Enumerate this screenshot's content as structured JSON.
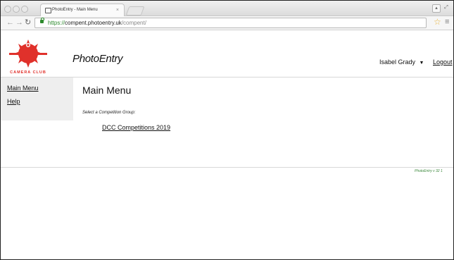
{
  "browser": {
    "tab_title": "PhotoEntry - Main Menu",
    "tab_close": "×",
    "url_scheme": "https://",
    "url_host": "compent.photoentry.uk",
    "url_path": "/compent/",
    "icons": [
      "back-icon",
      "forward-icon",
      "reload-icon",
      "lock-icon",
      "star-icon",
      "menu-icon"
    ]
  },
  "header": {
    "brand": "PhotoEntry",
    "user_name": "Isabel Grady",
    "user_dropdown": "▼",
    "logout_label": "Logout",
    "logo_text": "CAMERA CLUB"
  },
  "sidebar": {
    "items": [
      {
        "label": "Main Menu"
      },
      {
        "label": "Help"
      }
    ]
  },
  "main": {
    "title": "Main Menu",
    "prompt": "Select a Competition Group:",
    "groups": [
      {
        "label": "DCC Competitions 2019"
      }
    ]
  },
  "footer": {
    "version": "PhotoEntry v 32 1"
  },
  "colors": {
    "logo_red": "#e0312b",
    "secure_green": "#2e8b2e",
    "footer_green": "#3f8a3f"
  }
}
